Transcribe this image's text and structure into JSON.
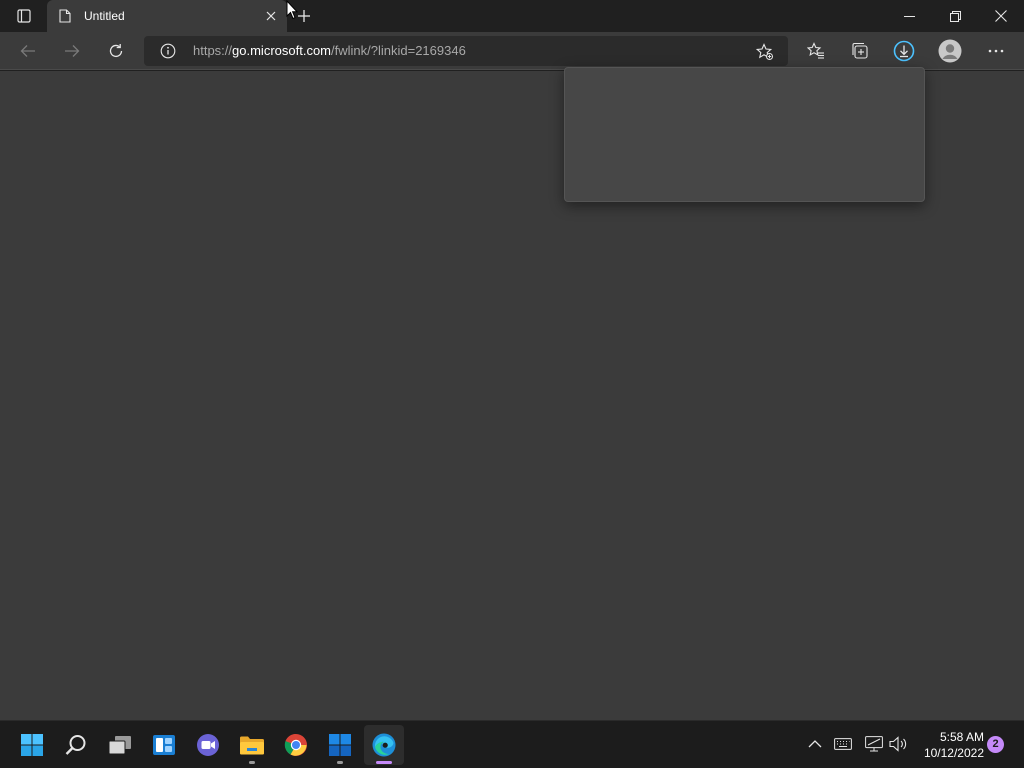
{
  "browser": {
    "tab": {
      "title": "Untitled"
    },
    "address": {
      "scheme": "https://",
      "host": "go.microsoft.com",
      "path": "/fwlink/?linkid=2169346"
    }
  },
  "taskbar": {
    "apps": [
      "windows-start-icon",
      "search-icon",
      "task-view-icon",
      "widgets-icon",
      "teams-chat-icon",
      "file-explorer-icon",
      "chrome-icon",
      "microsoft-store-icon",
      "edge-icon"
    ],
    "clock": {
      "time": "5:58 AM",
      "date": "10/12/2022"
    },
    "notification_count": "2"
  },
  "colors": {
    "accent": "#4cc2ff",
    "notification": "#c58af9",
    "surface": "#3b3b3b"
  }
}
